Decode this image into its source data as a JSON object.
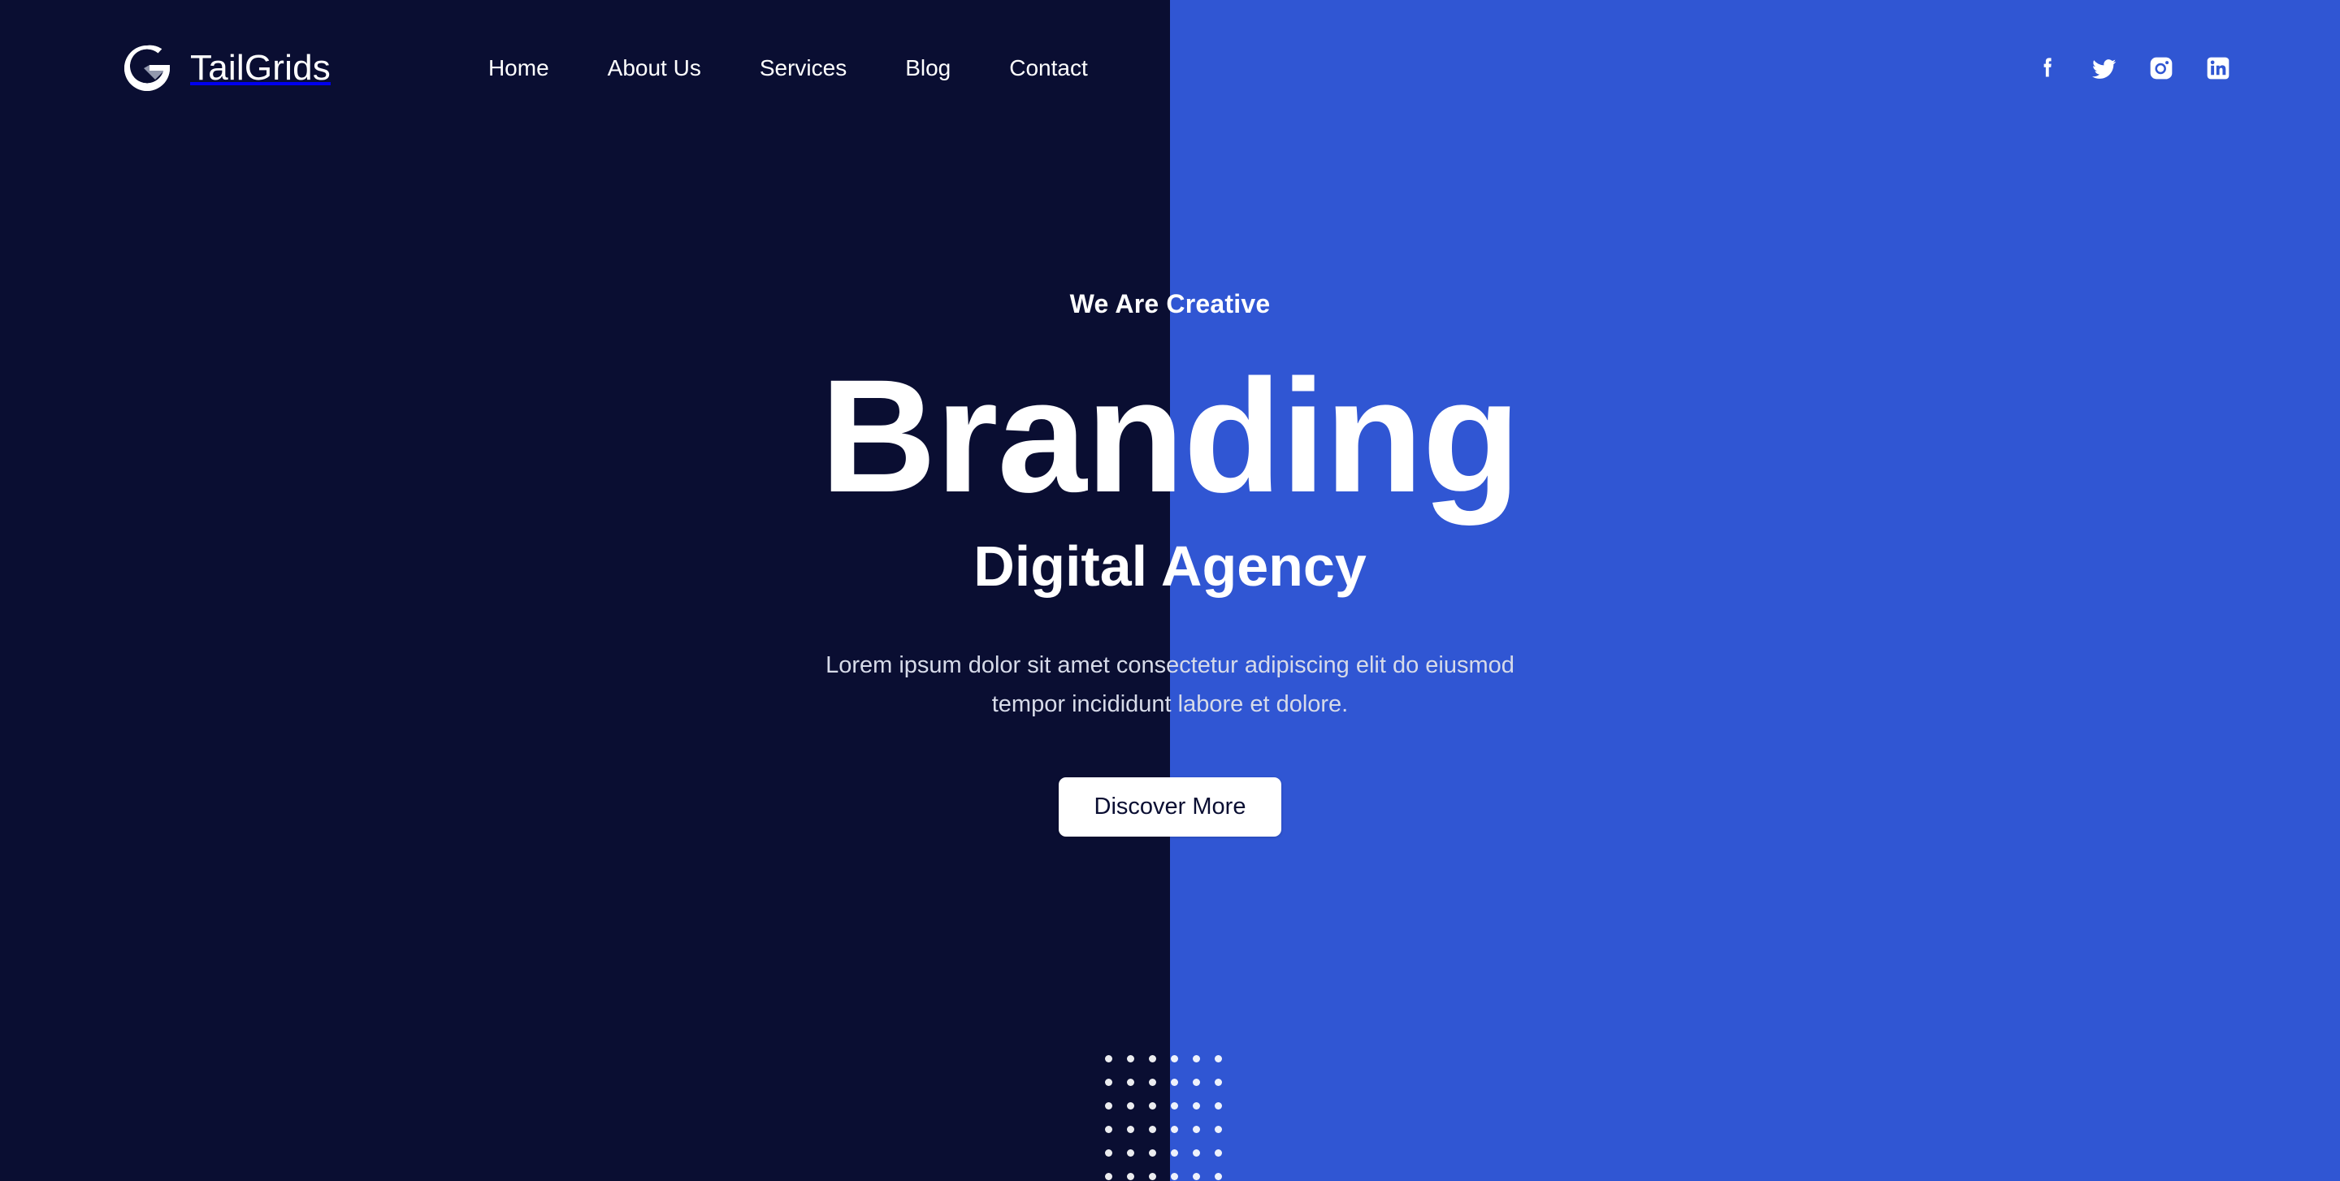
{
  "theme": {
    "dark_bg": "#0a0e32",
    "accent_blue": "#3056d3",
    "text_white": "#ffffff",
    "muted_text": "#d7dbe9",
    "button_bg": "#ffffff",
    "button_text": "#0a0e32",
    "logo_mark_accent": "#9aa0b4"
  },
  "header": {
    "brand": {
      "name": "TailGrids",
      "mark_icon": "tailgrids-g-logo-icon"
    },
    "nav": [
      {
        "label": "Home",
        "icon": "nav-item"
      },
      {
        "label": "About Us",
        "icon": "nav-item"
      },
      {
        "label": "Services",
        "icon": "nav-item"
      },
      {
        "label": "Blog",
        "icon": "nav-item"
      },
      {
        "label": "Contact",
        "icon": "nav-item"
      }
    ],
    "socials": [
      {
        "name": "facebook",
        "icon": "facebook-icon"
      },
      {
        "name": "twitter",
        "icon": "twitter-icon"
      },
      {
        "name": "instagram",
        "icon": "instagram-icon"
      },
      {
        "name": "linkedin",
        "icon": "linkedin-icon"
      }
    ]
  },
  "hero": {
    "eyebrow": "We Are Creative",
    "title": "Branding",
    "subtitle": "Digital Agency",
    "description": "Lorem ipsum dolor sit amet consectetur adipiscing elit do eiusmod tempor incididunt labore et dolore.",
    "cta_label": "Discover More"
  },
  "decoration": {
    "dot_grid": {
      "columns": 6,
      "rows": 6,
      "dot_color": "#ffffff"
    }
  }
}
